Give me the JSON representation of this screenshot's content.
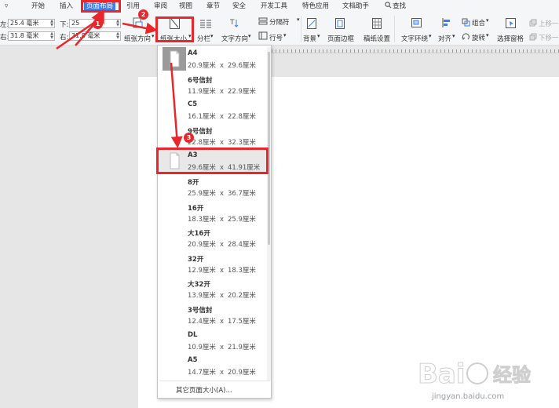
{
  "menubar": {
    "items": [
      {
        "label": "开始"
      },
      {
        "label": "插入"
      },
      {
        "label": "页面布局"
      },
      {
        "label": "引用"
      },
      {
        "label": "审阅"
      },
      {
        "label": "视图"
      },
      {
        "label": "章节"
      },
      {
        "label": "安全"
      },
      {
        "label": "开发工具"
      },
      {
        "label": "特色应用"
      },
      {
        "label": "文档助手"
      },
      {
        "label": "查找"
      }
    ]
  },
  "ribbon": {
    "margin_left_label": "左:",
    "margin_left_value": "25.4 毫米",
    "margin_right_label": "右:",
    "margin_right_value": "31.8 毫米",
    "margin_bottom_label": "下:",
    "margin_bottom_value": "25",
    "margin_right2_value": "31.8 毫米",
    "orientation": "纸张方向",
    "paper_size": "纸张大小",
    "columns": "分栏",
    "text_direction": "文字方向",
    "separator": "分隔符",
    "line_number": "行号",
    "background": "背景",
    "page_border": "页面边框",
    "manuscript": "稿纸设置",
    "text_wrap": "文字环绕",
    "align": "对齐",
    "group": "组合",
    "rotate": "旋转",
    "selection_pane": "选择窗格",
    "move_up": "上移一",
    "move_down": "下移一"
  },
  "paper_sizes": [
    {
      "name": "A4",
      "width": "20.9厘米",
      "height": "29.6厘米"
    },
    {
      "name": "6号信封",
      "width": "11.9厘米",
      "height": "22.9厘米"
    },
    {
      "name": "C5",
      "width": "16.1厘米",
      "height": "22.8厘米"
    },
    {
      "name": "9号信封",
      "width": "22.8厘米",
      "height": "32.3厘米"
    },
    {
      "name": "A3",
      "width": "29.6厘米",
      "height": "41.91厘米"
    },
    {
      "name": "8开",
      "width": "25.9厘米",
      "height": "36.7厘米"
    },
    {
      "name": "16开",
      "width": "18.3厘米",
      "height": "25.9厘米"
    },
    {
      "name": "大16开",
      "width": "20.9厘米",
      "height": "28.4厘米"
    },
    {
      "name": "32开",
      "width": "12.9厘米",
      "height": "18.3厘米"
    },
    {
      "name": "大32开",
      "width": "13.9厘米",
      "height": "20.2厘米"
    },
    {
      "name": "3号信封",
      "width": "12.4厘米",
      "height": "17.5厘米"
    },
    {
      "name": "DL",
      "width": "10.9厘米",
      "height": "21.9厘米"
    },
    {
      "name": "A5",
      "width": "14.7厘米",
      "height": "20.9厘米"
    }
  ],
  "paper_size_separator": "x",
  "selected_paper": "A3",
  "dropdown_footer": "其它页面大小(A)...",
  "annotations": {
    "step1": "1",
    "step2": "2",
    "step3": "3"
  },
  "watermark": {
    "brand": "Bai",
    "brand_cn": "经验",
    "url": "jingyan.baidu.com"
  },
  "colors": {
    "accent": "#3d7ff0",
    "annotation_red": "#e8262c",
    "selected_row": "#e8e8e8"
  }
}
